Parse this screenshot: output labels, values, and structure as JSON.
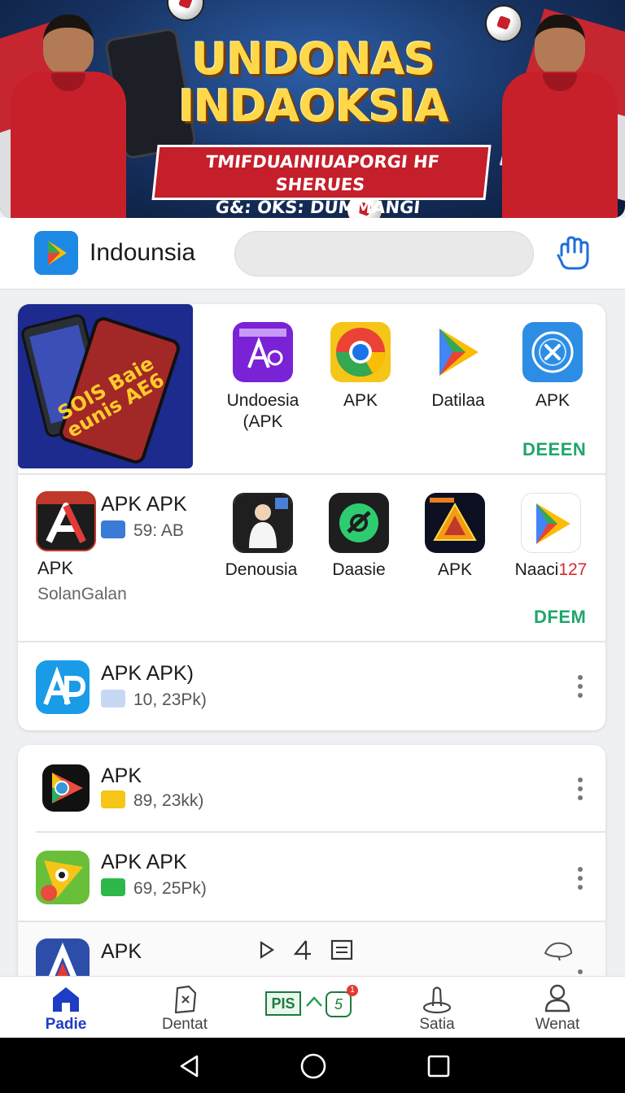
{
  "banner": {
    "title_line1": "UNDONAS",
    "title_line2": "INDAOKSIA",
    "subtitle_line1": "TMIFDUAINIUAPORGI HF SHERUES",
    "subtitle_line2": "G&: OKS: DUMMANGI ISIMODONIG!"
  },
  "header": {
    "app_name": "Indounsia",
    "search_placeholder": ""
  },
  "featured": {
    "promo_text": "SOIS Baie eunis AE6",
    "apps": [
      {
        "label": "Undoesia\n(APK",
        "icon": "apk-purple-icon"
      },
      {
        "label": "APK",
        "icon": "chrome-icon"
      },
      {
        "label": "Datilaa",
        "icon": "play-store-icon"
      },
      {
        "label": "APK",
        "icon": "x-circle-icon"
      }
    ],
    "more_label": "DEEEN"
  },
  "row2": {
    "main_app": {
      "title": "APK APK",
      "badge": "59: AB",
      "name": "APK",
      "developer": "SolanGalan"
    },
    "apps": [
      {
        "label": "Denousia",
        "icon": "person-icon"
      },
      {
        "label": "Daasie",
        "icon": "green-circle-icon"
      },
      {
        "label": "APK",
        "icon": "triangle-icon"
      },
      {
        "label_prefix": "Naaci",
        "label_suffix": "127",
        "icon": "play-store-icon"
      }
    ],
    "more_label": "DFEM"
  },
  "list1": [
    {
      "title": "APK APK)",
      "meta": "10, 23Pk)"
    }
  ],
  "list2": [
    {
      "title": "APK",
      "meta": "89, 23kk)"
    },
    {
      "title": "APK APK",
      "meta": "69, 25Pk)"
    },
    {
      "title": "APK",
      "meta": ""
    }
  ],
  "bottom_nav": {
    "items": [
      {
        "label": "Padie",
        "icon": "home-icon"
      },
      {
        "label": "Dentat",
        "icon": "document-icon"
      },
      {
        "label": "",
        "icon": "pis-icon"
      },
      {
        "label": "Satia",
        "icon": "joystick-icon"
      },
      {
        "label": "Wenat",
        "icon": "user-icon"
      }
    ],
    "pis_text": "PIS",
    "badge_text": "5",
    "badge_count": "1"
  },
  "colors": {
    "accent_blue": "#1f3cc4",
    "link_green": "#1fa66a",
    "banner_red": "#c41f2a",
    "title_yellow": "#ffd84a"
  }
}
